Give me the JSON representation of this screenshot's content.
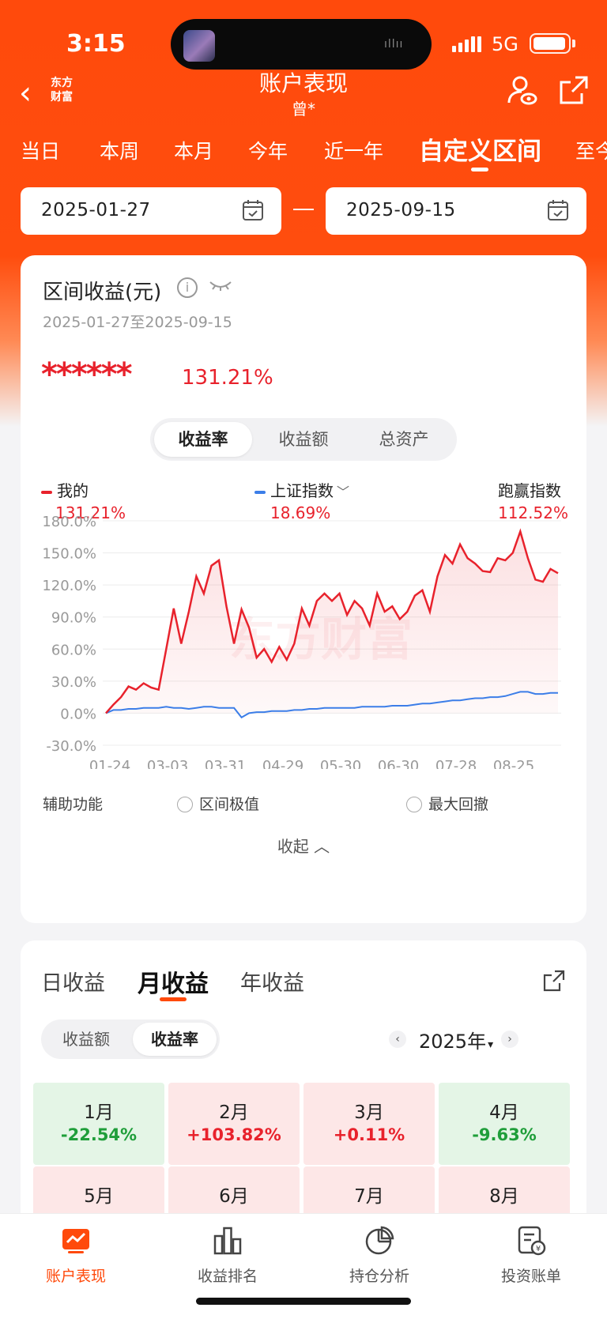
{
  "status": {
    "time": "3:15",
    "network": "5G"
  },
  "nav": {
    "logo_text_1": "东方",
    "logo_text_2": "财富",
    "title": "账户表现",
    "subtitle": "曾*"
  },
  "tabs": [
    "当日",
    "本周",
    "本月",
    "今年",
    "近一年",
    "自定义区间",
    "至今"
  ],
  "date_range": {
    "start": "2025-01-27",
    "end": "2025-09-15"
  },
  "summary": {
    "title": "区间收益(元)",
    "range_text": "2025-01-27至2025-09-15",
    "masked_amount": "******",
    "return_pct": "131.21%"
  },
  "segment": {
    "items": [
      "收益率",
      "收益额",
      "总资产"
    ],
    "active": 0
  },
  "legend": {
    "mine_label": "我的",
    "mine_value": "131.21%",
    "index_label": "上证指数",
    "index_value": "18.69%",
    "beat_label": "跑赢指数",
    "beat_value": "112.52%"
  },
  "colors": {
    "brand": "#ff4a0c",
    "mine": "#e8222c",
    "index": "#3c7ee8",
    "up": "#e8222c",
    "down": "#1f9e3a"
  },
  "chart_data": {
    "type": "line",
    "yticks": [
      "180.0%",
      "150.0%",
      "120.0%",
      "90.0%",
      "60.0%",
      "30.0%",
      "0.0%",
      "-30.0%"
    ],
    "xticks": [
      "01-24",
      "03-03",
      "03-31",
      "04-29",
      "05-30",
      "06-30",
      "07-28",
      "08-25"
    ],
    "ylim": [
      -30,
      180
    ],
    "watermark": "东方财富",
    "series": [
      {
        "name": "我的",
        "values": [
          0,
          8,
          15,
          25,
          22,
          28,
          24,
          22,
          60,
          98,
          65,
          95,
          128,
          112,
          138,
          143,
          100,
          65,
          97,
          80,
          52,
          60,
          48,
          62,
          50,
          65,
          98,
          82,
          105,
          112,
          105,
          112,
          92,
          105,
          98,
          82,
          112,
          95,
          100,
          88,
          95,
          110,
          115,
          95,
          128,
          148,
          140,
          158,
          145,
          140,
          133,
          132,
          145,
          143,
          150,
          170,
          145,
          125,
          123,
          135,
          131
        ]
      },
      {
        "name": "上证指数",
        "values": [
          0,
          3,
          3,
          4,
          4,
          5,
          5,
          5,
          6,
          5,
          5,
          4,
          5,
          6,
          6,
          5,
          5,
          5,
          -4,
          0,
          1,
          1,
          2,
          2,
          2,
          3,
          3,
          4,
          4,
          5,
          5,
          5,
          5,
          5,
          6,
          6,
          6,
          6,
          7,
          7,
          7,
          8,
          9,
          9,
          10,
          11,
          12,
          12,
          13,
          14,
          14,
          15,
          15,
          16,
          18,
          20,
          20,
          18,
          18,
          19,
          19
        ]
      }
    ]
  },
  "aux": {
    "label": "辅助功能",
    "opt1": "区间极值",
    "opt2": "最大回撤",
    "collapse": "收起"
  },
  "returns": {
    "tabs": [
      "日收益",
      "月收益",
      "年收益"
    ],
    "seg": [
      "收益额",
      "收益率"
    ],
    "year": "2025年",
    "months": [
      {
        "m": "1月",
        "r": "-22.54%",
        "dir": "down"
      },
      {
        "m": "2月",
        "r": "+103.82%",
        "dir": "up"
      },
      {
        "m": "3月",
        "r": "+0.11%",
        "dir": "up"
      },
      {
        "m": "4月",
        "r": "-9.63%",
        "dir": "down"
      },
      {
        "m": "5月",
        "r": "",
        "dir": "up"
      },
      {
        "m": "6月",
        "r": "",
        "dir": "up"
      },
      {
        "m": "7月",
        "r": "",
        "dir": "up"
      },
      {
        "m": "8月",
        "r": "",
        "dir": "up"
      }
    ]
  },
  "bottom_nav": [
    "账户表现",
    "收益排名",
    "持仓分析",
    "投资账单"
  ]
}
